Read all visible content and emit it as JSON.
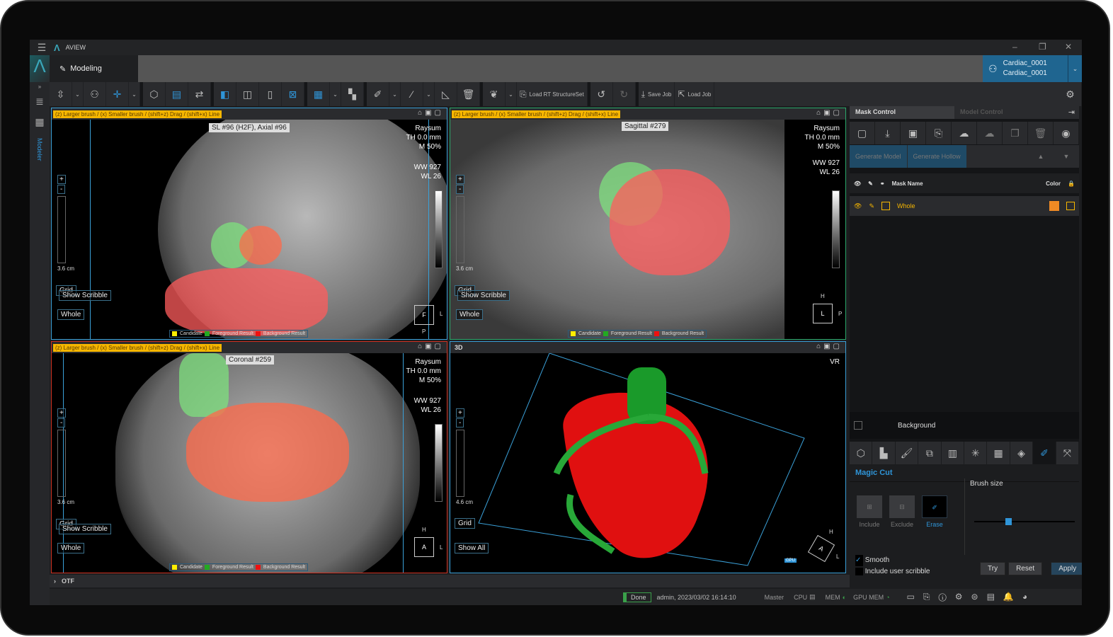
{
  "app": {
    "title": "AVIEW",
    "tab": "Modeling"
  },
  "patient": {
    "line1": "Cardiac_0001",
    "line2": "Cardiac_0001"
  },
  "sidebar": {
    "label": "Modeler"
  },
  "toolbar": {
    "load_rt": "Load RT StructureSet",
    "save_job": "Save Job",
    "load_job": "Load Job"
  },
  "viewports": {
    "hint": "(z) Larger brush / (x) Smaller brush / (shift+z) Drag / (shift+x) Line",
    "axial": {
      "label": "SL #96 (H2F),  Axial #96",
      "render": "Raysum",
      "th": "TH 0.0 mm",
      "m": "M 50%",
      "ww_label": "WW",
      "ww": "927",
      "wl_label": "WL",
      "wl": "26",
      "scale": "3.6 cm",
      "ori_box": "F",
      "ori_right": "L",
      "ori_bottom": "P"
    },
    "sagittal": {
      "label": "Sagittal #279",
      "render": "Raysum",
      "th": "TH 0.0 mm",
      "m": "M 50%",
      "ww_label": "WW",
      "ww": "927",
      "wl_label": "WL",
      "wl": "26",
      "scale": "3.6 cm",
      "ori_box": "L",
      "ori_right": "P",
      "ori_top": "H"
    },
    "coronal": {
      "label": "Coronal #259",
      "render": "Raysum",
      "th": "TH 0.0 mm",
      "m": "M 50%",
      "ww_label": "WW",
      "ww": "927",
      "wl_label": "WL",
      "wl": "26",
      "scale": "3.6 cm",
      "ori_box": "A",
      "ori_right": "L",
      "ori_top": "H"
    },
    "vr": {
      "title": "3D",
      "mode": "VR",
      "scale": "4.6 cm",
      "grid": "Grid",
      "show_all": "Show All",
      "gpu": "GPU",
      "ori_box": "A",
      "ori_top": "H",
      "ori_right": "L"
    },
    "grid": "Grid",
    "show_scribble": "Show Scribble",
    "whole": "Whole",
    "legend": {
      "candidate": "Candidate",
      "foreground": "Foreground Result",
      "background": "Background Result"
    }
  },
  "right_panel": {
    "tabs": [
      "Mask Control",
      "Model Control"
    ],
    "generate_model": "Generate Model",
    "generate_hollow": "Generate Hollow",
    "header": {
      "name": "Mask Name",
      "color": "Color"
    },
    "masks": [
      {
        "name": "Whole",
        "color": "#f08a24"
      }
    ],
    "background": "Background",
    "tool_title": "Magic Cut",
    "modes": [
      "Include",
      "Exclude",
      "Erase"
    ],
    "brush_size_label": "Brush size",
    "brush_size_fraction": 0.33,
    "smooth": "Smooth",
    "smooth_checked": true,
    "include_scribble": "Include user scribble",
    "include_scribble_checked": false,
    "try": "Try",
    "reset": "Reset",
    "apply": "Apply"
  },
  "otf": "OTF",
  "status": {
    "state": "Done",
    "user_time": "admin, 2023/03/02 16:14:10",
    "master": "Master",
    "cpu": "CPU",
    "mem": "MEM",
    "gpu_mem": "GPU MEM"
  },
  "colors": {
    "accent": "#2f95d8",
    "hint": "#f6b600",
    "candidate": "#ffee00",
    "foreground": "#22aa22",
    "background": "#ee1111"
  }
}
